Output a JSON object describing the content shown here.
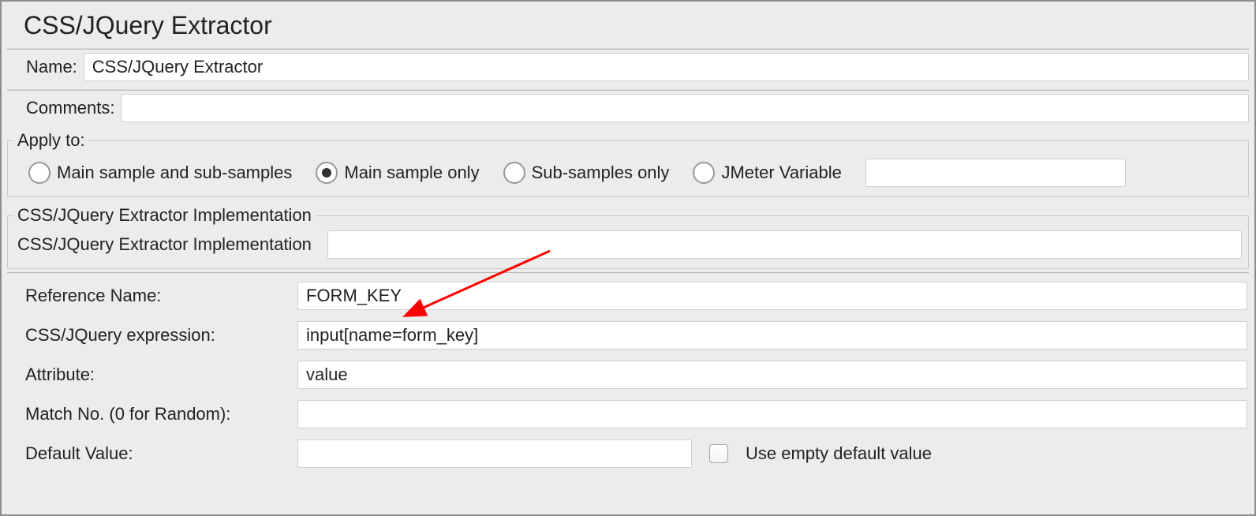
{
  "title": "CSS/JQuery Extractor",
  "name_label": "Name:",
  "name_value": "CSS/JQuery Extractor",
  "comments_label": "Comments:",
  "comments_value": "",
  "apply_to": {
    "legend": "Apply to:",
    "options": [
      {
        "label": "Main sample and sub-samples",
        "selected": false
      },
      {
        "label": "Main sample only",
        "selected": true
      },
      {
        "label": "Sub-samples only",
        "selected": false
      },
      {
        "label": "JMeter Variable",
        "selected": false
      }
    ],
    "jmeter_variable_value": ""
  },
  "impl_group": {
    "legend": "CSS/JQuery Extractor Implementation",
    "label": "CSS/JQuery Extractor Implementation",
    "value": ""
  },
  "fields": {
    "reference_name_label": "Reference Name:",
    "reference_name_value": "FORM_KEY",
    "css_expr_label": "CSS/JQuery expression:",
    "css_expr_value": "input[name=form_key]",
    "attribute_label": "Attribute:",
    "attribute_value": "value",
    "match_no_label": "Match No. (0 for Random):",
    "match_no_value": "",
    "default_value_label": "Default Value:",
    "default_value_value": "",
    "use_empty_label": "Use empty default value",
    "use_empty_checked": false
  },
  "annotation": {
    "color": "#ff0000"
  }
}
